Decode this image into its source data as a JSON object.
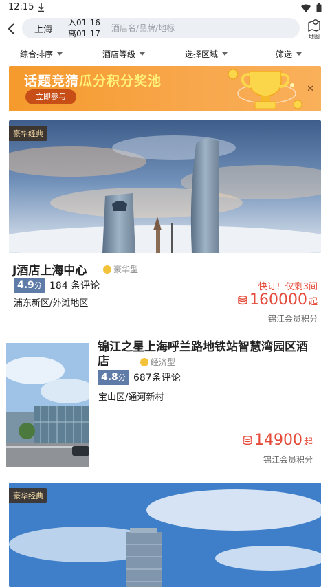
{
  "status": {
    "time": "12:15"
  },
  "search": {
    "city": "上海",
    "checkin": "入01-16",
    "checkout": "离01-17",
    "placeholder": "酒店名/品牌/地标",
    "map_label": "地图"
  },
  "filters": [
    "综合排序",
    "酒店等级",
    "选择区域",
    "筛选"
  ],
  "banner": {
    "title_plain": "话题竞猜",
    "title_highlight": "瓜分积分奖池",
    "button": "立即参与"
  },
  "hotels": [
    {
      "tag": "豪华经典",
      "name": "J酒店上海中心",
      "type": "豪华型",
      "score": "4.9",
      "score_unit": "分",
      "reviews": "184 条评论",
      "area": "浦东新区/外滩地区",
      "urgent": "快订！仅剩3间",
      "price": "160000",
      "price_unit": "起",
      "member": "锦江会员积分"
    },
    {
      "name": "锦江之星上海呼兰路地铁站智慧湾园区酒店",
      "type": "经济型",
      "score": "4.8",
      "score_unit": "分",
      "reviews": "687条评论",
      "area": "宝山区/通河新村",
      "price": "14900",
      "price_unit": "起",
      "member": "锦江会员积分"
    },
    {
      "tag": "豪华经典"
    }
  ],
  "colors": {
    "accent": "#e54b3a",
    "score_badge": "#5f7ba8",
    "banner": "#f59a2c"
  }
}
